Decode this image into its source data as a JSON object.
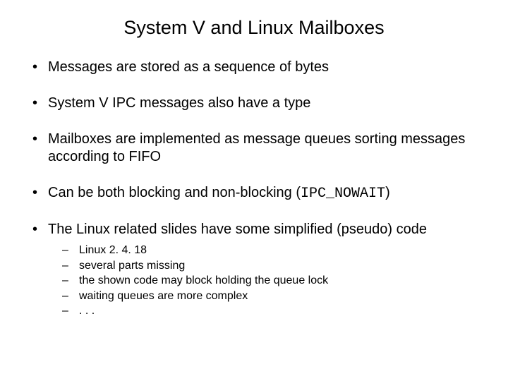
{
  "title": "System V and Linux Mailboxes",
  "bullets": {
    "b0": "Messages are stored as a sequence of bytes",
    "b1": "System V IPC messages also have a type",
    "b2": "Mailboxes are implemented as message queues sorting messages according to FIFO",
    "b3_pre": "Can be both blocking and non-blocking (",
    "b3_code": "IPC_NOWAIT",
    "b3_post": ")",
    "b4": "The Linux related slides have some simplified (pseudo) code"
  },
  "sub": {
    "s0": "Linux 2. 4. 18",
    "s1": "several parts missing",
    "s2": "the shown code may block holding the queue lock",
    "s3": "waiting queues are more complex",
    "s4": ". . ."
  }
}
